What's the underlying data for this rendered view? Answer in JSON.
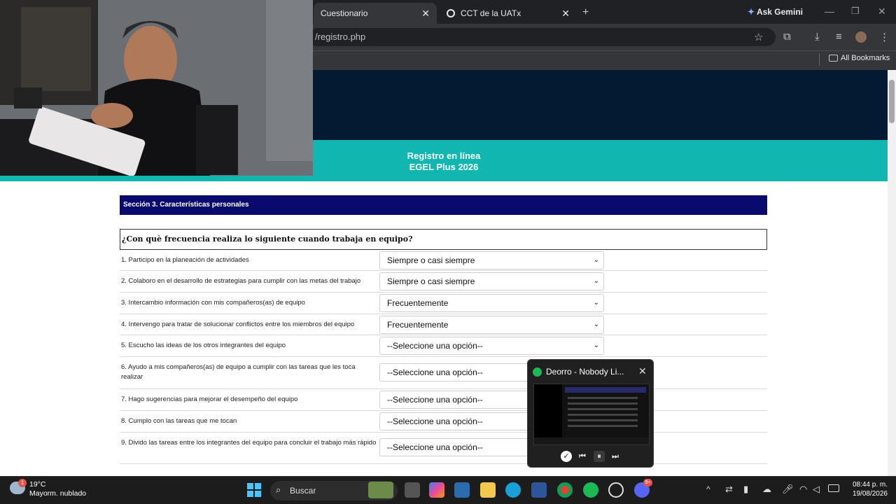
{
  "browser": {
    "tabs": [
      {
        "title": "Cuestionario",
        "active": true
      },
      {
        "title": "CCT de la UATx",
        "active": false
      }
    ],
    "new_tab_symbol": "+",
    "ask_gemini": "Ask Gemini",
    "url": "/registro.php",
    "all_bookmarks": "All Bookmarks"
  },
  "page": {
    "banner_line1": "Registro en línea",
    "banner_line2": "EGEL Plus 2026",
    "section_title": "Sección 3. Características personales",
    "question": "¿Con què frecuencia realiza lo siguiente cuando trabaja en equipo?",
    "items": [
      {
        "label": "1. Participo en la planeación de actividades",
        "value": "Siempre o casi siempre"
      },
      {
        "label": "2. Colaboro en el desarrollo de estrategias para cumplir con las metas del trabajo",
        "value": "Siempre o casi siempre"
      },
      {
        "label": "3. Intercambio información con mis compañeros(as) de equipo",
        "value": "Frecuentemente"
      },
      {
        "label": "4. Intervengo para tratar de solucionar conflictos entre los miembros del equipo",
        "value": "Frecuentemente"
      },
      {
        "label": "5. Escucho las ideas de los otros integrantes del equipo",
        "value": "--Seleccione una opción--"
      },
      {
        "label": "6. Ayudo a mis compañeros(as) de equipo a cumplir con las tareas que les toca realizar",
        "value": "--Seleccione una opción--"
      },
      {
        "label": "7. Hago sugerencias para mejorar el desempeño del equipo",
        "value": "--Seleccione una opción--"
      },
      {
        "label": "8. Cumplo con las tareas que me tocan",
        "value": "--Seleccione una opción--"
      },
      {
        "label": "9. Divido las tareas entre los integrantes del equipo para concluir el trabajo más rápido",
        "value": "--Seleccione una opción--"
      }
    ]
  },
  "mini_player": {
    "title": "Deorro - Nobody Li..."
  },
  "taskbar": {
    "weather_temp": "19°C",
    "weather_desc": "Mayorm. nublado",
    "weather_badge": "1",
    "search_label": "Buscar",
    "time": "08:44 p. m.",
    "date": "19/08/2026",
    "discord_badge": "9+"
  },
  "colors": {
    "banner_dark": "#041a33",
    "banner_teal": "#12b6b0",
    "section_bar": "#0a0a6e",
    "spotify_green": "#1db954"
  }
}
